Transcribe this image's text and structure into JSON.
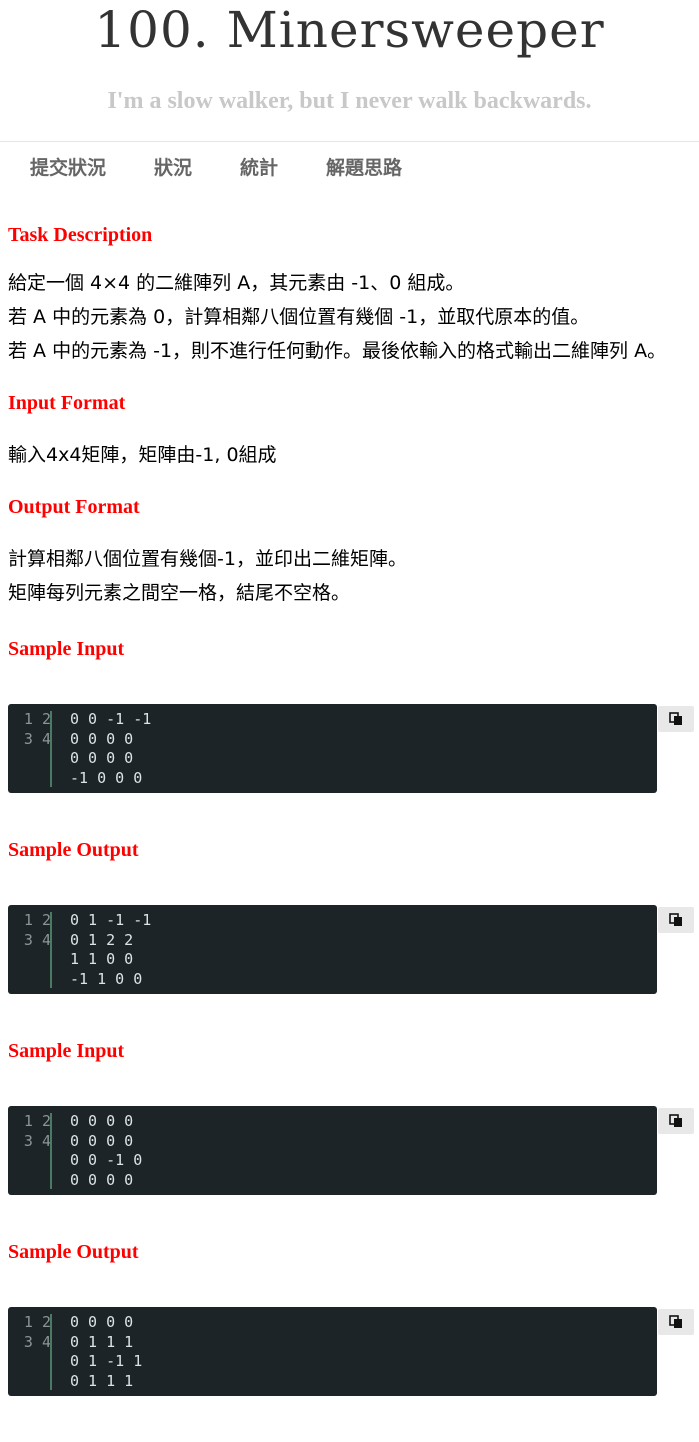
{
  "header": {
    "title": "100. Minersweeper",
    "subtitle": "I'm a slow walker, but I never walk backwards."
  },
  "nav": {
    "tabs": [
      "提交狀況",
      "狀況",
      "統計",
      "解題思路"
    ]
  },
  "sections": {
    "task_description": {
      "heading": "Task Description",
      "text": "給定一個 4×4 的二維陣列 A，其元素由 -1、0 組成。\n若 A 中的元素為 0，計算相鄰八個位置有幾個 -1，並取代原本的值。\n若 A 中的元素為 -1，則不進行任何動作。最後依輸入的格式輸出二維陣列 A。"
    },
    "input_format": {
      "heading": "Input Format",
      "text": "輸入4x4矩陣，矩陣由-1, 0組成"
    },
    "output_format": {
      "heading": "Output Format",
      "text": "計算相鄰八個位置有幾個-1，並印出二維矩陣。\n矩陣每列元素之間空一格，結尾不空格。"
    }
  },
  "samples": [
    {
      "heading": "Sample Input",
      "line_numbers": "1\n2\n3\n4",
      "code": "0 0 -1 -1\n0 0 0 0\n0 0 0 0\n-1 0 0 0"
    },
    {
      "heading": "Sample Output",
      "line_numbers": "1\n2\n3\n4",
      "code": "0 1 -1 -1\n0 1 2 2\n1 1 0 0\n-1 1 0 0"
    },
    {
      "heading": "Sample Input",
      "line_numbers": "1\n2\n3\n4",
      "code": "0 0 0 0\n0 0 0 0\n0 0 -1 0\n0 0 0 0"
    },
    {
      "heading": "Sample Output",
      "line_numbers": "1\n2\n3\n4",
      "code": "0 0 0 0\n0 1 1 1\n0 1 -1 1\n0 1 1 1"
    }
  ],
  "icons": {
    "copy": "copy-icon"
  },
  "colors": {
    "heading": "#ff0000",
    "code_bg": "#1c2427",
    "code_text": "#dde3e5",
    "gutter": "#4a7a62"
  }
}
